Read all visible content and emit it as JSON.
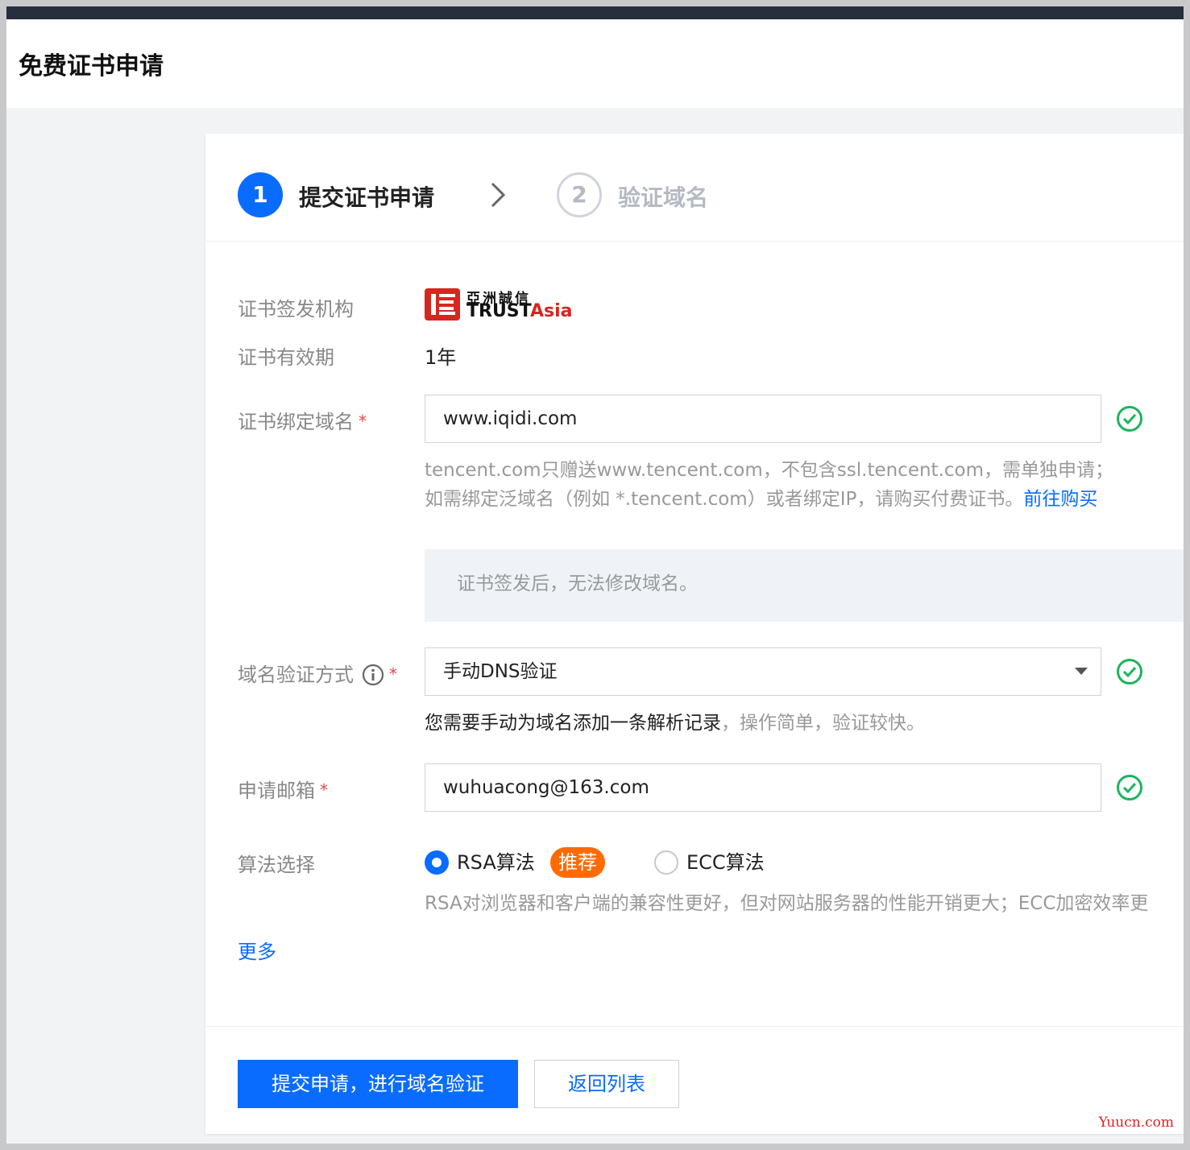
{
  "page": {
    "title": "免费证书申请"
  },
  "steps": [
    {
      "number": "1",
      "label": "提交证书申请",
      "active": true
    },
    {
      "number": "2",
      "label": "验证域名",
      "active": false
    }
  ],
  "form": {
    "issuer": {
      "label": "证书签发机构",
      "logo_text_cn": "亞洲誠信",
      "logo_text_en_left": "TRUST",
      "logo_text_en_right": "Asia",
      "logo_icon": "trustasia-logo"
    },
    "validity": {
      "label": "证书有效期",
      "value": "1年"
    },
    "domain": {
      "label": "证书绑定域名",
      "required_mark": "*",
      "value": "www.iqidi.com",
      "help_line1": "tencent.com只赠送www.tencent.com，不包含ssl.tencent.com，需单独申请；",
      "help_line2": "如需绑定泛域名（例如 *.tencent.com）或者绑定IP，请购买付费证书。",
      "help_link": "前往购买",
      "notice": "证书签发后，无法修改域名。"
    },
    "verification": {
      "label": "域名验证方式",
      "required_mark": "*",
      "selected": "手动DNS验证",
      "desc_main": "您需要手动为域名添加一条解析记录",
      "desc_rest": "，操作简单，验证较快。"
    },
    "email": {
      "label": "申请邮箱",
      "required_mark": "*",
      "value": "wuhuacong@163.com"
    },
    "algorithm": {
      "label": "算法选择",
      "options": [
        {
          "label": "RSA算法",
          "selected": true
        },
        {
          "label": "ECC算法",
          "selected": false
        }
      ],
      "badge": "推荐",
      "help": "RSA对浏览器和客户端的兼容性更好，但对网站服务器的性能开销更大；ECC加密效率更"
    },
    "more_link": "更多"
  },
  "actions": {
    "submit": "提交申请，进行域名验证",
    "back": "返回列表"
  },
  "watermark": "Yuucn.com",
  "colors": {
    "primary": "#0a6cff",
    "success": "#1bb55c",
    "required": "#e54545",
    "badge": "#ff6b00",
    "topbar": "#262f3e"
  }
}
